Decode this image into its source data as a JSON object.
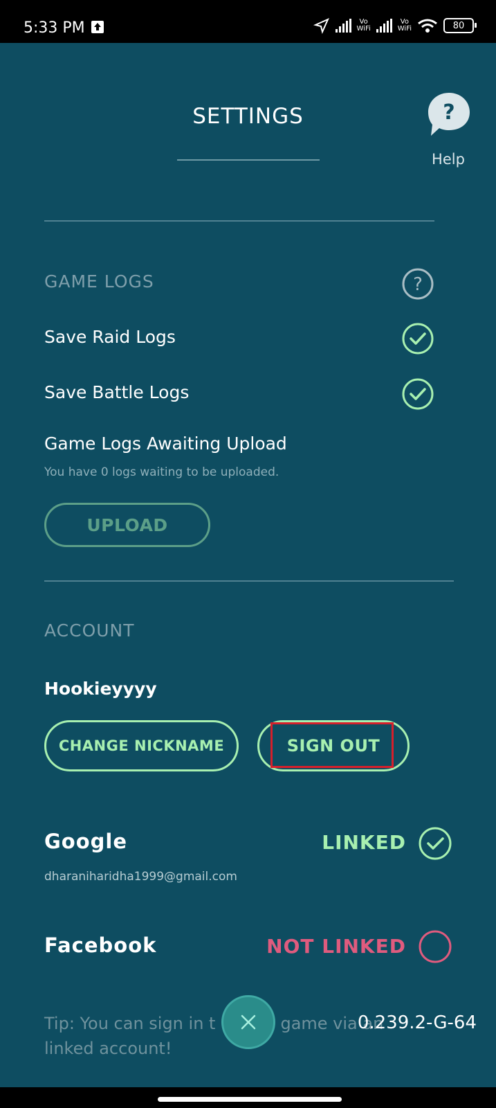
{
  "status_bar": {
    "time": "5:33 PM",
    "vowifi_label": "Vo\nWiFi",
    "battery": "80"
  },
  "header": {
    "title": "SETTINGS",
    "help_label": "Help",
    "help_icon": "question-bubble-icon"
  },
  "game_logs": {
    "heading": "GAME LOGS",
    "save_raid_logs": {
      "label": "Save Raid Logs",
      "checked": true
    },
    "save_battle_logs": {
      "label": "Save Battle Logs",
      "checked": true
    },
    "awaiting_upload_label": "Game Logs Awaiting Upload",
    "awaiting_upload_sub": "You have 0 logs waiting to be uploaded.",
    "upload_button": "UPLOAD"
  },
  "account": {
    "heading": "ACCOUNT",
    "nickname": "Hookieyyyy",
    "change_nickname_button": "CHANGE NICKNAME",
    "sign_out_button": "SIGN OUT",
    "google": {
      "label": "Google",
      "email": "dharaniharidha1999@gmail.com",
      "status": "LINKED"
    },
    "facebook": {
      "label": "Facebook",
      "status": "NOT LINKED"
    }
  },
  "footer": {
    "tip": "Tip: You can sign in t        game via any\nlinked account!",
    "version": "0.239.2-G-64"
  },
  "colors": {
    "background": "#0e4d61",
    "accent_green": "#a8f0b0",
    "not_linked_pink": "#e05b7e",
    "highlight_red": "#d61f2b"
  }
}
